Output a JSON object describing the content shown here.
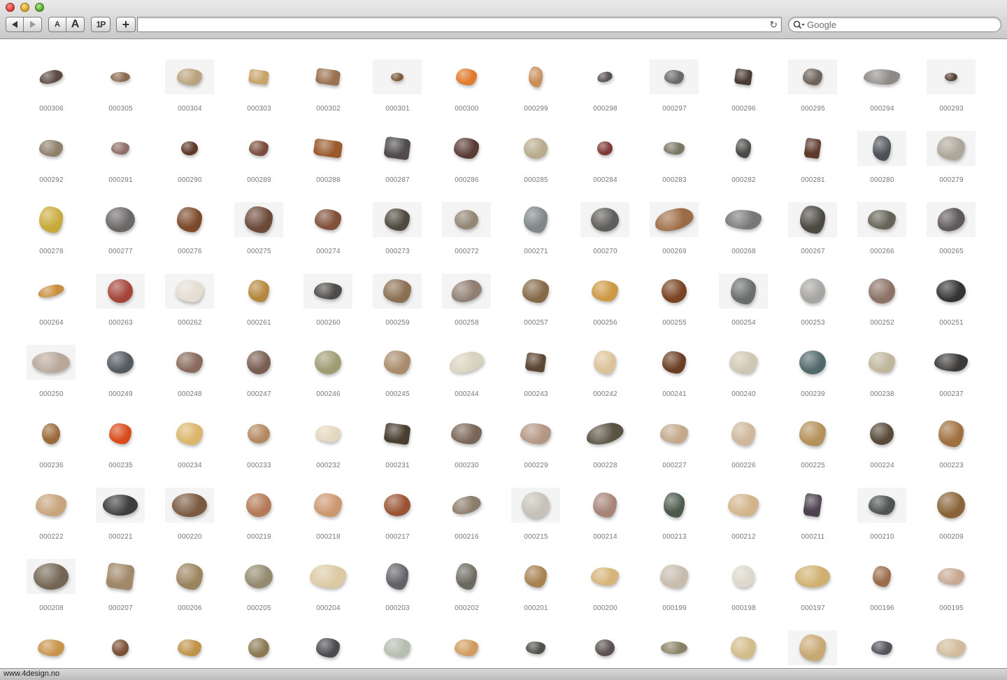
{
  "window": {
    "nav": {
      "back_icon": "left-triangle",
      "forward_icon": "right-triangle"
    },
    "toolbar": {
      "text_smaller_label": "A",
      "text_bigger_label": "A",
      "onepassword_label": "1P",
      "new_tab_label": "+"
    },
    "address": {
      "value": "",
      "reload_icon": "↻"
    },
    "search": {
      "placeholder": "Google",
      "icon": "magnifier-dropdown"
    },
    "status": {
      "text": "www.4design.no"
    }
  },
  "gallery": {
    "items": [
      {
        "label": "000306",
        "color": "#5c4a44",
        "w": 34,
        "h": 18,
        "shape": "flat"
      },
      {
        "label": "000305",
        "color": "#8b6b4f",
        "w": 28,
        "h": 14,
        "shape": "oval"
      },
      {
        "label": "000304",
        "color": "#b9a37e",
        "w": 36,
        "h": 24,
        "shape": "rough",
        "bg": true
      },
      {
        "label": "000303",
        "color": "#c9a46a",
        "w": 28,
        "h": 20,
        "shape": "block"
      },
      {
        "label": "000302",
        "color": "#9a7252",
        "w": 34,
        "h": 22,
        "shape": "block"
      },
      {
        "label": "000301",
        "color": "#7d5a3c",
        "w": 18,
        "h": 12,
        "shape": "oval",
        "bg": true
      },
      {
        "label": "000300",
        "color": "#e07a2c",
        "w": 30,
        "h": 24,
        "shape": "rough"
      },
      {
        "label": "000299",
        "color": "#c98e5a",
        "w": 20,
        "h": 30,
        "shape": "rough"
      },
      {
        "label": "000298",
        "color": "#5a5354",
        "w": 22,
        "h": 14,
        "shape": "flat"
      },
      {
        "label": "000297",
        "color": "#6a6a6c",
        "w": 28,
        "h": 20,
        "shape": "rough",
        "bg": true
      },
      {
        "label": "000296",
        "color": "#4a3c34",
        "w": 24,
        "h": 22,
        "shape": "block"
      },
      {
        "label": "000295",
        "color": "#6e6259",
        "w": 28,
        "h": 24,
        "shape": "rough",
        "bg": true
      },
      {
        "label": "000294",
        "color": "#8d8a86",
        "w": 52,
        "h": 22,
        "shape": "rough"
      },
      {
        "label": "000293",
        "color": "#5a4438",
        "w": 18,
        "h": 12,
        "shape": "oval",
        "bg": true
      },
      {
        "label": "000292",
        "color": "#8e8069",
        "w": 34,
        "h": 24,
        "shape": "rough"
      },
      {
        "label": "000291",
        "color": "#8f7067",
        "w": 26,
        "h": 18,
        "shape": "rough"
      },
      {
        "label": "000290",
        "color": "#5e3828",
        "w": 24,
        "h": 20,
        "shape": "oval"
      },
      {
        "label": "000289",
        "color": "#7b4c3e",
        "w": 28,
        "h": 22,
        "shape": "rough"
      },
      {
        "label": "000288",
        "color": "#9a5a2c",
        "w": 40,
        "h": 24,
        "shape": "block"
      },
      {
        "label": "000287",
        "color": "#4f4c4b",
        "w": 36,
        "h": 30,
        "shape": "block"
      },
      {
        "label": "000286",
        "color": "#5b3c35",
        "w": 36,
        "h": 30,
        "shape": "rough"
      },
      {
        "label": "000285",
        "color": "#b9ab8c",
        "w": 34,
        "h": 30,
        "shape": "oval"
      },
      {
        "label": "000284",
        "color": "#7e3a34",
        "w": 22,
        "h": 20,
        "shape": "oval"
      },
      {
        "label": "000283",
        "color": "#7a7763",
        "w": 30,
        "h": 18,
        "shape": "rough"
      },
      {
        "label": "000282",
        "color": "#4a4b48",
        "w": 22,
        "h": 28,
        "shape": "rough"
      },
      {
        "label": "000281",
        "color": "#5e3a2c",
        "w": 22,
        "h": 28,
        "shape": "block"
      },
      {
        "label": "000280",
        "color": "#4e5257",
        "w": 26,
        "h": 36,
        "shape": "rough",
        "bg": true
      },
      {
        "label": "000279",
        "color": "#aea69a",
        "w": 40,
        "h": 34,
        "shape": "rough",
        "bg": true
      },
      {
        "label": "000278",
        "color": "#c8aa3c",
        "w": 34,
        "h": 38,
        "shape": "rough"
      },
      {
        "label": "000277",
        "color": "#6b6968",
        "w": 42,
        "h": 36,
        "shape": "oval"
      },
      {
        "label": "000276",
        "color": "#7c4a2a",
        "w": 36,
        "h": 36,
        "shape": "rough"
      },
      {
        "label": "000275",
        "color": "#6c4a3a",
        "w": 40,
        "h": 38,
        "shape": "rough",
        "bg": true
      },
      {
        "label": "000274",
        "color": "#805038",
        "w": 38,
        "h": 30,
        "shape": "rough"
      },
      {
        "label": "000273",
        "color": "#4f4a40",
        "w": 36,
        "h": 32,
        "shape": "rough",
        "bg": true
      },
      {
        "label": "000272",
        "color": "#938675",
        "w": 34,
        "h": 28,
        "shape": "oval",
        "bg": true
      },
      {
        "label": "000271",
        "color": "#7f8789",
        "w": 34,
        "h": 38,
        "shape": "rough"
      },
      {
        "label": "000270",
        "color": "#5f5e5c",
        "w": 40,
        "h": 34,
        "shape": "oval",
        "bg": true
      },
      {
        "label": "000269",
        "color": "#9d6c46",
        "w": 56,
        "h": 30,
        "shape": "flat",
        "bg": true
      },
      {
        "label": "000268",
        "color": "#797878",
        "w": 52,
        "h": 28,
        "shape": "rough"
      },
      {
        "label": "000267",
        "color": "#4c4942",
        "w": 36,
        "h": 40,
        "shape": "rough",
        "bg": true
      },
      {
        "label": "000266",
        "color": "#666458",
        "w": 40,
        "h": 28,
        "shape": "rough",
        "bg": true
      },
      {
        "label": "000265",
        "color": "#60595a",
        "w": 40,
        "h": 32,
        "shape": "flat",
        "bg": true
      },
      {
        "label": "000264",
        "color": "#c98e3e",
        "w": 38,
        "h": 16,
        "shape": "flat"
      },
      {
        "label": "000263",
        "color": "#a4453a",
        "w": 36,
        "h": 34,
        "shape": "oval",
        "bg": true
      },
      {
        "label": "000262",
        "color": "#e4ddd2",
        "w": 40,
        "h": 32,
        "shape": "rough",
        "bg": true
      },
      {
        "label": "000261",
        "color": "#b5883e",
        "w": 30,
        "h": 32,
        "shape": "rough"
      },
      {
        "label": "000260",
        "color": "#4e4c48",
        "w": 40,
        "h": 24,
        "shape": "rough",
        "bg": true
      },
      {
        "label": "000259",
        "color": "#8c7054",
        "w": 40,
        "h": 34,
        "shape": "rough",
        "bg": true
      },
      {
        "label": "000258",
        "color": "#907e72",
        "w": 44,
        "h": 30,
        "shape": "flat",
        "bg": true
      },
      {
        "label": "000257",
        "color": "#856a48",
        "w": 38,
        "h": 34,
        "shape": "rough"
      },
      {
        "label": "000256",
        "color": "#cc9944",
        "w": 38,
        "h": 30,
        "shape": "rough"
      },
      {
        "label": "000255",
        "color": "#7a4424",
        "w": 36,
        "h": 34,
        "shape": "oval"
      },
      {
        "label": "000254",
        "color": "#6c6e6e",
        "w": 36,
        "h": 38,
        "shape": "rough",
        "bg": true
      },
      {
        "label": "000253",
        "color": "#a8a6a2",
        "w": 36,
        "h": 36,
        "shape": "oval"
      },
      {
        "label": "000252",
        "color": "#8c7266",
        "w": 38,
        "h": 36,
        "shape": "oval"
      },
      {
        "label": "000251",
        "color": "#333434",
        "w": 42,
        "h": 32,
        "shape": "oval"
      },
      {
        "label": "000250",
        "color": "#b8a89a",
        "w": 54,
        "h": 30,
        "shape": "oval",
        "bg": true
      },
      {
        "label": "000249",
        "color": "#545a60",
        "w": 38,
        "h": 32,
        "shape": "oval"
      },
      {
        "label": "000248",
        "color": "#8a6a5c",
        "w": 38,
        "h": 30,
        "shape": "rough"
      },
      {
        "label": "000247",
        "color": "#7a5e52",
        "w": 34,
        "h": 34,
        "shape": "oval"
      },
      {
        "label": "000246",
        "color": "#9f9c74",
        "w": 38,
        "h": 34,
        "shape": "oval"
      },
      {
        "label": "000245",
        "color": "#a88c6c",
        "w": 38,
        "h": 34,
        "shape": "rough"
      },
      {
        "label": "000244",
        "color": "#d9d2bf",
        "w": 50,
        "h": 28,
        "shape": "flat"
      },
      {
        "label": "000243",
        "color": "#5c4634",
        "w": 28,
        "h": 26,
        "shape": "block"
      },
      {
        "label": "000242",
        "color": "#dcc39b",
        "w": 32,
        "h": 34,
        "shape": "rough"
      },
      {
        "label": "000241",
        "color": "#6a3e24",
        "w": 34,
        "h": 32,
        "shape": "rough"
      },
      {
        "label": "000240",
        "color": "#d0c7b3",
        "w": 40,
        "h": 32,
        "shape": "rough"
      },
      {
        "label": "000239",
        "color": "#53686a",
        "w": 38,
        "h": 34,
        "shape": "oval"
      },
      {
        "label": "000238",
        "color": "#c0b69c",
        "w": 38,
        "h": 30,
        "shape": "rough"
      },
      {
        "label": "000237",
        "color": "#3c3a38",
        "w": 48,
        "h": 26,
        "shape": "rough"
      },
      {
        "label": "000236",
        "color": "#9a6a3a",
        "w": 26,
        "h": 30,
        "shape": "oval"
      },
      {
        "label": "000235",
        "color": "#d84c1c",
        "w": 32,
        "h": 30,
        "shape": "rough"
      },
      {
        "label": "000234",
        "color": "#dcb66a",
        "w": 38,
        "h": 32,
        "shape": "rough"
      },
      {
        "label": "000233",
        "color": "#b48860",
        "w": 32,
        "h": 28,
        "shape": "oval"
      },
      {
        "label": "000232",
        "color": "#e4d8c0",
        "w": 36,
        "h": 24,
        "shape": "rough"
      },
      {
        "label": "000231",
        "color": "#4a3e30",
        "w": 36,
        "h": 28,
        "shape": "block"
      },
      {
        "label": "000230",
        "color": "#7a6658",
        "w": 44,
        "h": 30,
        "shape": "rough"
      },
      {
        "label": "000229",
        "color": "#b49684",
        "w": 44,
        "h": 30,
        "shape": "rough"
      },
      {
        "label": "000228",
        "color": "#5a5344",
        "w": 54,
        "h": 28,
        "shape": "flat"
      },
      {
        "label": "000227",
        "color": "#c4a88c",
        "w": 40,
        "h": 28,
        "shape": "rough"
      },
      {
        "label": "000226",
        "color": "#d0b69c",
        "w": 34,
        "h": 34,
        "shape": "rough"
      },
      {
        "label": "000225",
        "color": "#b4905a",
        "w": 38,
        "h": 36,
        "shape": "rough"
      },
      {
        "label": "000224",
        "color": "#584a3a",
        "w": 34,
        "h": 32,
        "shape": "oval"
      },
      {
        "label": "000223",
        "color": "#a07040",
        "w": 36,
        "h": 38,
        "shape": "rough"
      },
      {
        "label": "000222",
        "color": "#c8a47c",
        "w": 44,
        "h": 32,
        "shape": "rough"
      },
      {
        "label": "000221",
        "color": "#3c3c3c",
        "w": 50,
        "h": 30,
        "shape": "oval",
        "bg": true
      },
      {
        "label": "000220",
        "color": "#7a5a40",
        "w": 50,
        "h": 34,
        "shape": "oval",
        "bg": true
      },
      {
        "label": "000219",
        "color": "#b47a58",
        "w": 36,
        "h": 34,
        "shape": "oval"
      },
      {
        "label": "000218",
        "color": "#cc9870",
        "w": 40,
        "h": 34,
        "shape": "rough"
      },
      {
        "label": "000217",
        "color": "#9a5434",
        "w": 38,
        "h": 32,
        "shape": "oval"
      },
      {
        "label": "000216",
        "color": "#8c7c6c",
        "w": 42,
        "h": 24,
        "shape": "flat"
      },
      {
        "label": "000215",
        "color": "#c6c2b8",
        "w": 40,
        "h": 38,
        "shape": "oval",
        "bg": true
      },
      {
        "label": "000214",
        "color": "#a88478",
        "w": 34,
        "h": 36,
        "shape": "rough"
      },
      {
        "label": "000213",
        "color": "#4c5a4c",
        "w": 30,
        "h": 36,
        "shape": "rough"
      },
      {
        "label": "000212",
        "color": "#d2b48a",
        "w": 44,
        "h": 32,
        "shape": "rough"
      },
      {
        "label": "000211",
        "color": "#4e4250",
        "w": 24,
        "h": 32,
        "shape": "block"
      },
      {
        "label": "000210",
        "color": "#4e5452",
        "w": 38,
        "h": 28,
        "shape": "rough",
        "bg": true
      },
      {
        "label": "000209",
        "color": "#8a6438",
        "w": 40,
        "h": 38,
        "shape": "oval"
      },
      {
        "label": "000208",
        "color": "#736654",
        "w": 50,
        "h": 38,
        "shape": "oval",
        "bg": true
      },
      {
        "label": "000207",
        "color": "#a08868",
        "w": 38,
        "h": 36,
        "shape": "block"
      },
      {
        "label": "000206",
        "color": "#9c8460",
        "w": 38,
        "h": 38,
        "shape": "rough"
      },
      {
        "label": "000205",
        "color": "#948a70",
        "w": 40,
        "h": 34,
        "shape": "oval"
      },
      {
        "label": "000204",
        "color": "#dcc9a4",
        "w": 52,
        "h": 34,
        "shape": "rough"
      },
      {
        "label": "000203",
        "color": "#626268",
        "w": 32,
        "h": 38,
        "shape": "rough"
      },
      {
        "label": "000202",
        "color": "#6c6a60",
        "w": 30,
        "h": 38,
        "shape": "rough"
      },
      {
        "label": "000201",
        "color": "#a88252",
        "w": 32,
        "h": 32,
        "shape": "rough"
      },
      {
        "label": "000200",
        "color": "#d6b47a",
        "w": 40,
        "h": 26,
        "shape": "rough"
      },
      {
        "label": "000199",
        "color": "#c8bcae",
        "w": 40,
        "h": 34,
        "shape": "rough"
      },
      {
        "label": "000198",
        "color": "#dcd8cc",
        "w": 32,
        "h": 32,
        "shape": "oval"
      },
      {
        "label": "000197",
        "color": "#d0b070",
        "w": 50,
        "h": 32,
        "shape": "oval"
      },
      {
        "label": "000196",
        "color": "#9a6c4c",
        "w": 26,
        "h": 30,
        "shape": "rough"
      },
      {
        "label": "000195",
        "color": "#c8a894",
        "w": 38,
        "h": 24,
        "shape": "rough"
      },
      {
        "label": "",
        "color": "#c8944c",
        "w": 38,
        "h": 24,
        "shape": "rough"
      },
      {
        "label": "",
        "color": "#7a5036",
        "w": 24,
        "h": 24,
        "shape": "oval"
      },
      {
        "label": "",
        "color": "#c0924a",
        "w": 34,
        "h": 24,
        "shape": "rough"
      },
      {
        "label": "",
        "color": "#8c7a54",
        "w": 30,
        "h": 28,
        "shape": "oval"
      },
      {
        "label": "",
        "color": "#4c4c4e",
        "w": 34,
        "h": 28,
        "shape": "rough"
      },
      {
        "label": "",
        "color": "#b6beb0",
        "w": 38,
        "h": 28,
        "shape": "rough"
      },
      {
        "label": "",
        "color": "#d29c60",
        "w": 34,
        "h": 24,
        "shape": "rough"
      },
      {
        "label": "",
        "color": "#52504c",
        "w": 28,
        "h": 18,
        "shape": "rough"
      },
      {
        "label": "",
        "color": "#5a5250",
        "w": 28,
        "h": 24,
        "shape": "oval"
      },
      {
        "label": "",
        "color": "#8a8268",
        "w": 38,
        "h": 18,
        "shape": "oval"
      },
      {
        "label": "",
        "color": "#d2bc8a",
        "w": 36,
        "h": 32,
        "shape": "rough"
      },
      {
        "label": "",
        "color": "#c8a874",
        "w": 38,
        "h": 38,
        "shape": "rough",
        "bg": true
      },
      {
        "label": "",
        "color": "#52545a",
        "w": 30,
        "h": 20,
        "shape": "rough"
      },
      {
        "label": "",
        "color": "#d0bc9c",
        "w": 42,
        "h": 26,
        "shape": "rough"
      }
    ]
  }
}
